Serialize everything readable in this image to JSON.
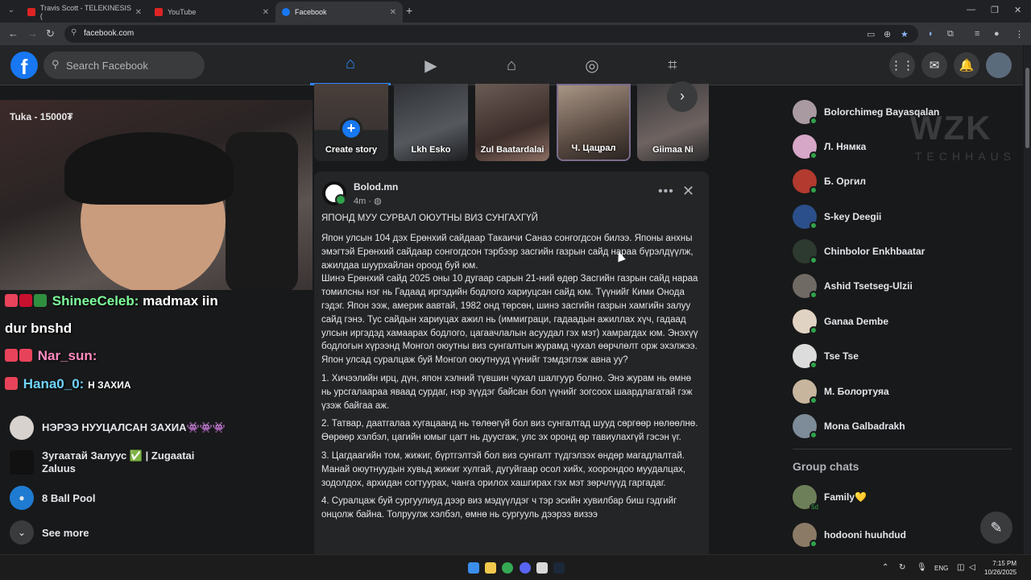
{
  "browser": {
    "tabs": [
      {
        "label": "Travis Scott - TELEKINESIS (",
        "color": "#e02424"
      },
      {
        "label": "YouTube",
        "color": "#e02424"
      },
      {
        "label": "Facebook",
        "color": "#1877f2"
      }
    ],
    "url": "facebook.com"
  },
  "header": {
    "search_placeholder": "Search Facebook",
    "nav_icons": [
      "home-icon",
      "video-icon",
      "marketplace-icon",
      "groups-icon",
      "gaming-icon"
    ],
    "accent": "#2d88ff"
  },
  "stream": {
    "donation_label": "Tuka - 15000₮",
    "chat": [
      {
        "name": "ShineeCeleb:",
        "text": "madmax iin"
      },
      {
        "name": "",
        "text": "dur bnshd"
      },
      {
        "name": "Nar_sun:",
        "text": ""
      },
      {
        "name": "Hana0_0:",
        "text": "Н ЗАХИА"
      }
    ]
  },
  "left_shortcuts": [
    {
      "label": "НЭРЭЭ НУУЦАЛСАН ЗАХИА👾👾👾"
    },
    {
      "label": "Зугаатай Залуус ✅ | Zugaatai Zaluus"
    },
    {
      "label": "8 Ball Pool"
    },
    {
      "label": "See more"
    }
  ],
  "stories": {
    "create_label": "Create story",
    "items": [
      "Lkh Esko",
      "Zul Baatardalai",
      "Ч. Цацрал",
      "Giimaa Ni"
    ]
  },
  "post": {
    "author": "Bolod.mn",
    "time": "4m ·",
    "title": "ЯПОНД МУУ СУРВАЛ ОЮУТНЫ ВИЗ СУНГАХГҮЙ",
    "paragraphs": [
      "Япон улсын 104 дэх Ерөнхий сайдаар Такаичи Санаэ сонгогдсон билээ. Японы анхны эмэгтэй Ерөнхий сайдаар сонгогдсон тэрбээр засгийн газрын сайд нараа бүрэлдүүлж, ажилдаа шуурхайлан ороод буй юм.",
      "Шинэ Ерөнхий сайд 2025 оны 10 дугаар сарын 21-ний өдөр Засгийн газрын сайд нараа томилсны нэг нь Гадаад иргэдийн бодлого хариуцсан сайд юм. Түүнийг Кими Онода гэдэг. Япон ээж, америк аавтай, 1982 онд төрсөн, шинэ засгийн газрын хамгийн залуу сайд гэнэ. Тус сайдын хариуцах ажил нь (иммиграци, гадаадын ажиллах хүч, гадаад улсын иргэдэд хамаарах бодлого, цагаачлалын асуудал гэх мэт) хамрагдах юм. Энэхүү бодлогын хүрээнд Монгол оюутны виз сунгалтын журамд чухал өөрчлөлт орж эхэлжээ.",
      "Япон улсад суралцаж буй Монгол оюутнууд үүнийг тэмдэглэж авна уу?",
      "1. Хичээлийн ирц, дүн, япон хэлний түвшин чухал шалгуур болно. Энэ журам нь өмнө нь урсгалаараа яваад сурдаг, нэр зүүдэг байсан бол үүнийг зогсоох шаардлагатай гэж үзэж байгаа аж.",
      "2. Татвар, даатгалаа хугацаанд нь төлөөгүй бол виз сунгалтад шууд сөргөөр нөлөөлнө. Өөрөөр хэлбэл, цагийн юмыг цагт нь дуусгаж, улс эх оронд өр тавиулахгүй гэсэн үг.",
      "3. Цагдаагийн том, жижиг, бүртгэлтэй бол виз сунгалт түдгэлзэх өндөр магадлалтай. Манай оюутнуудын хувьд жижиг хулгай, дугуйгаар осол хийх, хоорондоо муудалцах, зодолдох, архидан согтуурах, чанга орилох хашгирах гэх мэт зөрчлүүд гаргадаг.",
      "4. Суралцаж буй сургуулиуд дээр виз мэдүүлдэг ч тэр эсийн хувилбар биш гэдгийг онцолж байна. Толруулж хэлбэл, өмнө нь сургууль дээрээ визээ"
    ]
  },
  "contacts": [
    {
      "name": "Bolorchimeg Bayasqalan",
      "color": "#a89aa0"
    },
    {
      "name": "Л. Нямка",
      "color": "#d6a7c7"
    },
    {
      "name": "Б. Оргил",
      "color": "#b23a2e"
    },
    {
      "name": "S-key Deegii",
      "color": "#2b4f8a"
    },
    {
      "name": "Chinbolor Enkhbaatar",
      "color": "#2d3a2f"
    },
    {
      "name": "Ashid Tsetseg-Ulzii",
      "color": "#6f6a63"
    },
    {
      "name": "Ganaa Dembe",
      "color": "#e1d3c3"
    },
    {
      "name": "Tse Tse",
      "color": "#dcdcdc"
    },
    {
      "name": "М. Болортуяа",
      "color": "#c7b59e"
    },
    {
      "name": "Mona Galbadrakh",
      "color": "#7d8c98"
    }
  ],
  "group_chats": {
    "title": "Group chats",
    "items": [
      {
        "name": "Family💛",
        "badge": "5d",
        "color": "#6d7f58"
      },
      {
        "name": "hodooni huuhdud",
        "badge": "",
        "color": "#8a7a66"
      }
    ]
  },
  "watermark": {
    "main": "WZK",
    "sub": "TECHHAUS"
  },
  "taskbar": {
    "lang": "ENG",
    "time": "7:15 PM",
    "date": "10/26/2025"
  }
}
